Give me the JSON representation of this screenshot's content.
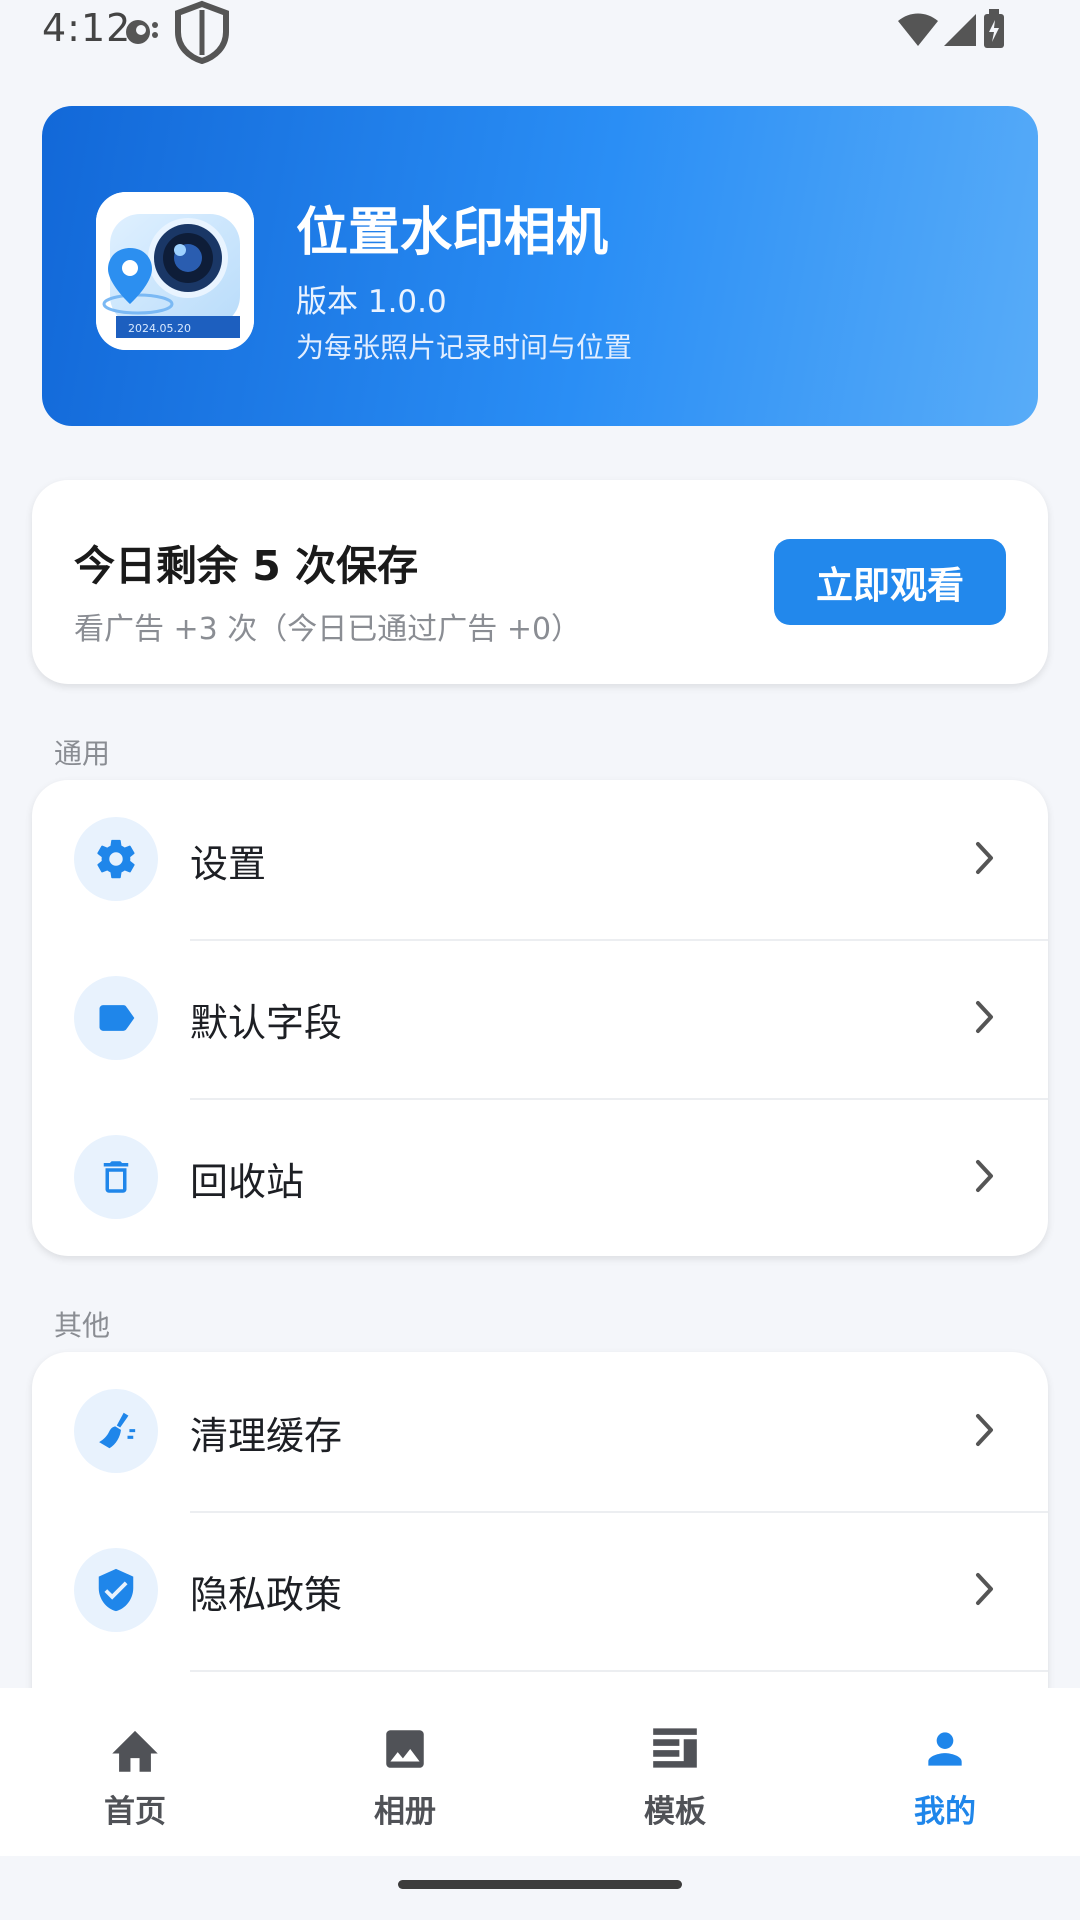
{
  "status_bar": {
    "time": "4:12",
    "icons": [
      "notification-icon",
      "shield-icon",
      "wifi-icon",
      "signal-icon",
      "battery-charging-icon"
    ]
  },
  "header": {
    "app_name": "位置水印相机",
    "version": "版本 1.0.0",
    "tagline": "为每张照片记录时间与位置",
    "logo": {
      "icon": "camera-location-logo",
      "caption": "2024.05.20"
    },
    "gradient": [
      "#1268d8",
      "#58acf8"
    ]
  },
  "quota": {
    "title": "今日剩余 5 次保存",
    "subtitle": "看广告 +3 次（今日已通过广告 +0）",
    "button_label": "立即观看"
  },
  "sections": {
    "general": {
      "label": "通用",
      "items": [
        {
          "label": "设置",
          "icon": "gear-icon"
        },
        {
          "label": "默认字段",
          "icon": "tag-icon"
        },
        {
          "label": "回收站",
          "icon": "trash-icon"
        }
      ]
    },
    "other": {
      "label": "其他",
      "items": [
        {
          "label": "清理缓存",
          "icon": "broom-icon"
        },
        {
          "label": "隐私政策",
          "icon": "shield-check-icon"
        }
      ]
    }
  },
  "bottom_nav": {
    "items": [
      {
        "label": "首页",
        "icon": "home-icon",
        "active": false
      },
      {
        "label": "相册",
        "icon": "image-icon",
        "active": false
      },
      {
        "label": "模板",
        "icon": "template-icon",
        "active": false
      },
      {
        "label": "我的",
        "icon": "person-icon",
        "active": true
      }
    ]
  },
  "colors": {
    "accent": "#2288ec",
    "background": "#f4f6fa",
    "icon_bg": "#e8f2fd"
  }
}
